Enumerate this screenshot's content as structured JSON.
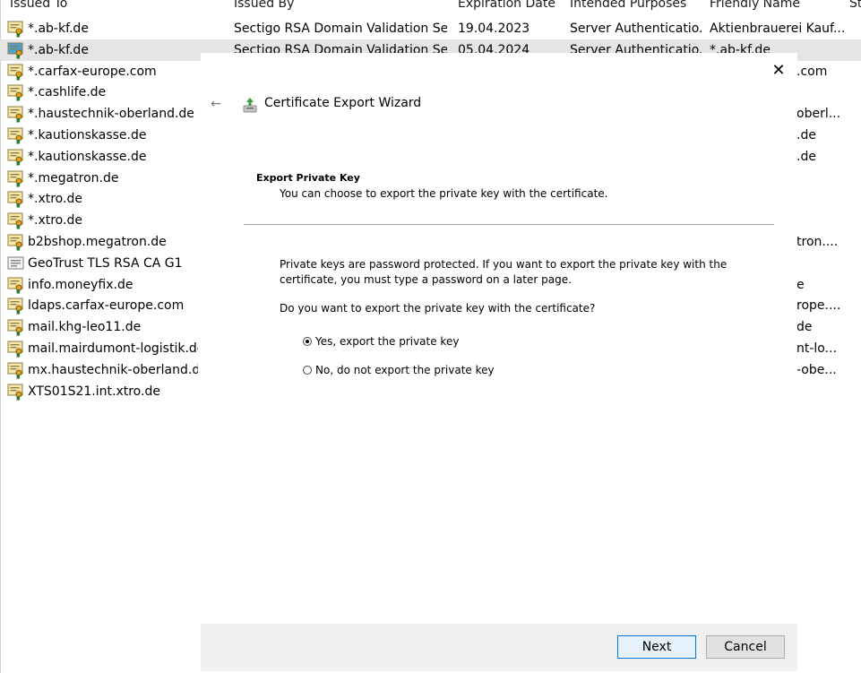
{
  "columns": [
    {
      "label": "Issued To"
    },
    {
      "label": "Issued By"
    },
    {
      "label": "Expiration Date"
    },
    {
      "label": "Intended Purposes"
    },
    {
      "label": "Friendly Name"
    },
    {
      "label": "St"
    }
  ],
  "rows": [
    {
      "issued_to": "*.ab-kf.de",
      "issued_by": "Sectigo RSA Domain Validation Sec...",
      "expiration": "19.04.2023",
      "purposes": "Server Authenticatio...",
      "friendly": "Aktienbrauerei Kauf...",
      "icon": "certificate-icon"
    },
    {
      "issued_to": "*.ab-kf.de",
      "issued_by": "Sectigo RSA Domain Validation Sec...",
      "expiration": "05.04.2024",
      "purposes": "Server Authenticatio...",
      "friendly": "*.ab-kf.de",
      "icon": "certificate-icon",
      "selected": true
    },
    {
      "issued_to": "*.carfax-europe.com",
      "friendly": ".com",
      "icon": "certificate-icon"
    },
    {
      "issued_to": "*.cashlife.de",
      "icon": "certificate-icon"
    },
    {
      "issued_to": "*.haustechnik-oberland.de",
      "friendly": "oberl...",
      "icon": "certificate-icon"
    },
    {
      "issued_to": "*.kautionskasse.de",
      "friendly": ".de",
      "icon": "certificate-icon"
    },
    {
      "issued_to": "*.kautionskasse.de",
      "friendly": ".de",
      "icon": "certificate-icon"
    },
    {
      "issued_to": "*.megatron.de",
      "icon": "certificate-icon"
    },
    {
      "issued_to": "*.xtro.de",
      "icon": "certificate-icon"
    },
    {
      "issued_to": "*.xtro.de",
      "icon": "certificate-icon"
    },
    {
      "issued_to": "b2bshop.megatron.de",
      "friendly": "tron....",
      "icon": "certificate-icon"
    },
    {
      "issued_to": "GeoTrust TLS RSA CA G1",
      "icon": "ca-certificate-icon"
    },
    {
      "issued_to": "info.moneyfix.de",
      "friendly": "e",
      "icon": "certificate-icon"
    },
    {
      "issued_to": "ldaps.carfax-europe.com",
      "friendly": "rope....",
      "icon": "certificate-icon"
    },
    {
      "issued_to": "mail.khg-leo11.de",
      "friendly": "de",
      "icon": "certificate-icon"
    },
    {
      "issued_to": "mail.mairdumont-logistik.de",
      "friendly": "nt-lo...",
      "icon": "certificate-icon"
    },
    {
      "issued_to": "mx.haustechnik-oberland.de",
      "friendly": "-obe...",
      "icon": "certificate-icon"
    },
    {
      "issued_to": "XTS01S21.int.xtro.de",
      "icon": "certificate-icon"
    }
  ],
  "wizard": {
    "title": "Certificate Export Wizard",
    "section_title": "Export Private Key",
    "section_subtitle": "You can choose to export the private key with the certificate.",
    "paragraph": "Private keys are password protected. If you want to export the private key with the certificate, you must type a password on a later page.",
    "question": "Do you want to export the private key with the certificate?",
    "options": [
      {
        "label": "Yes, export the private key",
        "selected": true
      },
      {
        "label": "No, do not export the private key",
        "selected": false
      }
    ],
    "next_label": "Next",
    "cancel_label": "Cancel",
    "close_glyph": "✕",
    "back_glyph": "←"
  }
}
